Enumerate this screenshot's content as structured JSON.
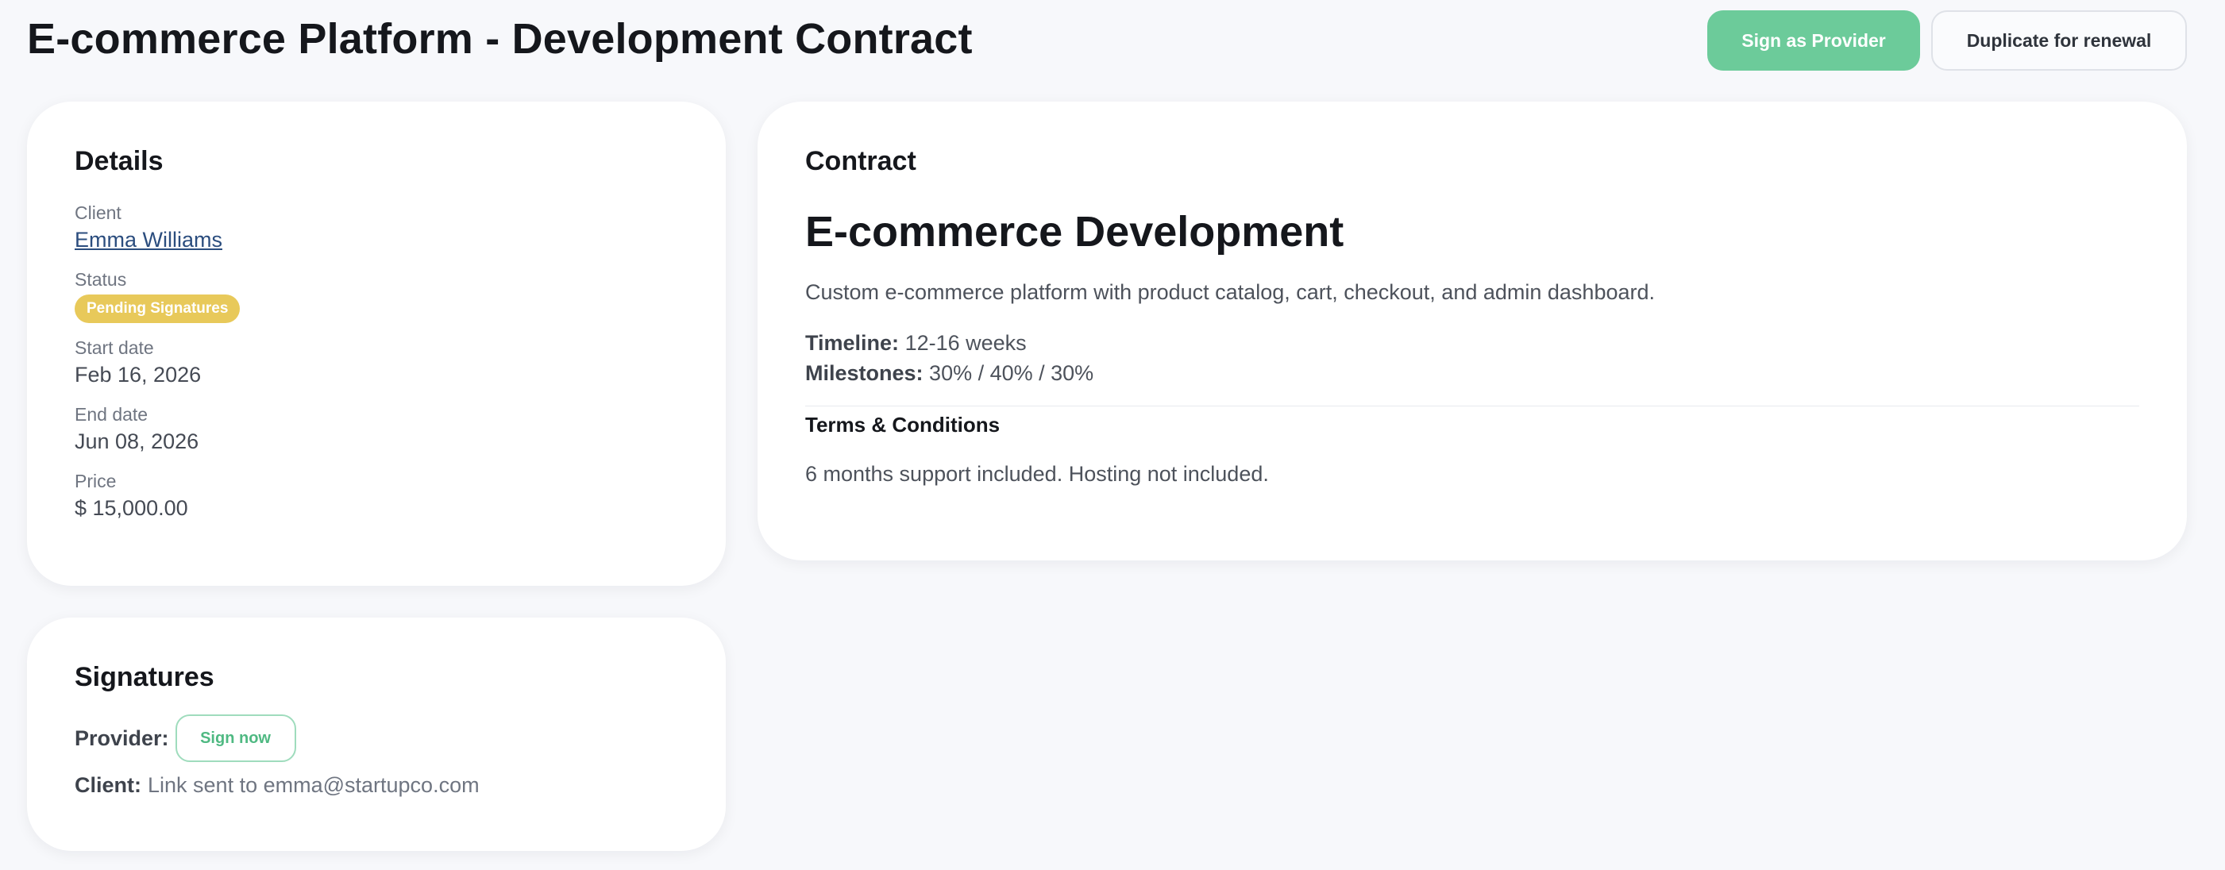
{
  "header": {
    "title": "E-commerce Platform - Development Contract",
    "sign_button": "Sign as Provider",
    "duplicate_button": "Duplicate for renewal"
  },
  "details": {
    "title": "Details",
    "client_label": "Client",
    "client_value": "Emma Williams",
    "status_label": "Status",
    "status_value": "Pending Signatures",
    "start_label": "Start date",
    "start_value": "Feb 16, 2026",
    "end_label": "End date",
    "end_value": "Jun 08, 2026",
    "price_label": "Price",
    "price_value": "$ 15,000.00"
  },
  "signatures": {
    "title": "Signatures",
    "provider_label": "Provider:",
    "provider_action": "Sign now",
    "client_label": "Client:",
    "client_value": "Link sent to emma@startupco.com"
  },
  "contract": {
    "section_title": "Contract",
    "heading": "E-commerce Development",
    "description": "Custom e-commerce platform with product catalog, cart, checkout, and admin dashboard.",
    "timeline_label": "Timeline:",
    "timeline_value": "12-16 weeks",
    "milestones_label": "Milestones:",
    "milestones_value": "30% / 40% / 30%",
    "terms_title": "Terms & Conditions",
    "terms_text": "6 months support included. Hosting not included."
  },
  "colors": {
    "primary": "#6ccb9a",
    "status_badge": "#e8c95a",
    "link": "#2b4d7e",
    "background": "#f7f8fb"
  }
}
